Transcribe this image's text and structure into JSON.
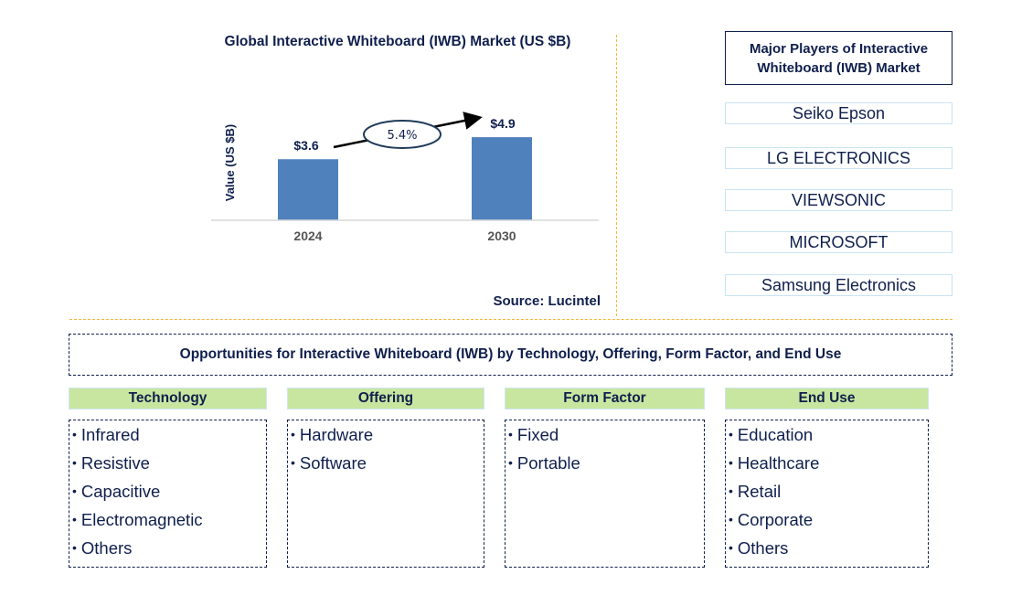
{
  "chart_data": {
    "type": "bar",
    "title": "Global Interactive Whiteboard (IWB) Market (US $B)",
    "xlabel": "",
    "ylabel": "Value (US $B)",
    "categories": [
      "2024",
      "2030"
    ],
    "values": [
      3.6,
      4.9
    ],
    "data_labels": [
      "$3.6",
      "$4.9"
    ],
    "ylim": [
      0,
      7.6
    ],
    "grid": false,
    "bar_color": "#4f81bd",
    "annotation": {
      "type": "cagr-arrow",
      "label": "5.4%",
      "from": "2024",
      "to": "2030"
    },
    "source": "Source: Lucintel"
  },
  "players": {
    "title": "Major Players of Interactive Whiteboard (IWB) Market",
    "items": [
      "Seiko Epson",
      "LG ELECTRONICS",
      "VIEWSONIC",
      "MICROSOFT",
      "Samsung Electronics"
    ]
  },
  "opportunities": {
    "title": "Opportunities for Interactive Whiteboard (IWB) by Technology, Offering, Form Factor, and End Use",
    "categories": [
      {
        "name": "Technology",
        "items": [
          "Infrared",
          "Resistive",
          "Capacitive",
          "Electromagnetic",
          "Others"
        ]
      },
      {
        "name": "Offering",
        "items": [
          "Hardware",
          "Software"
        ]
      },
      {
        "name": "Form Factor",
        "items": [
          "Fixed",
          "Portable"
        ]
      },
      {
        "name": "End Use",
        "items": [
          "Education",
          "Healthcare",
          "Retail",
          "Corporate",
          "Others"
        ]
      }
    ]
  },
  "colors": {
    "text": "#0f1f4d",
    "bar": "#4f81bd",
    "header_fill": "#c8e6a0",
    "divider": "#f5b63c"
  }
}
